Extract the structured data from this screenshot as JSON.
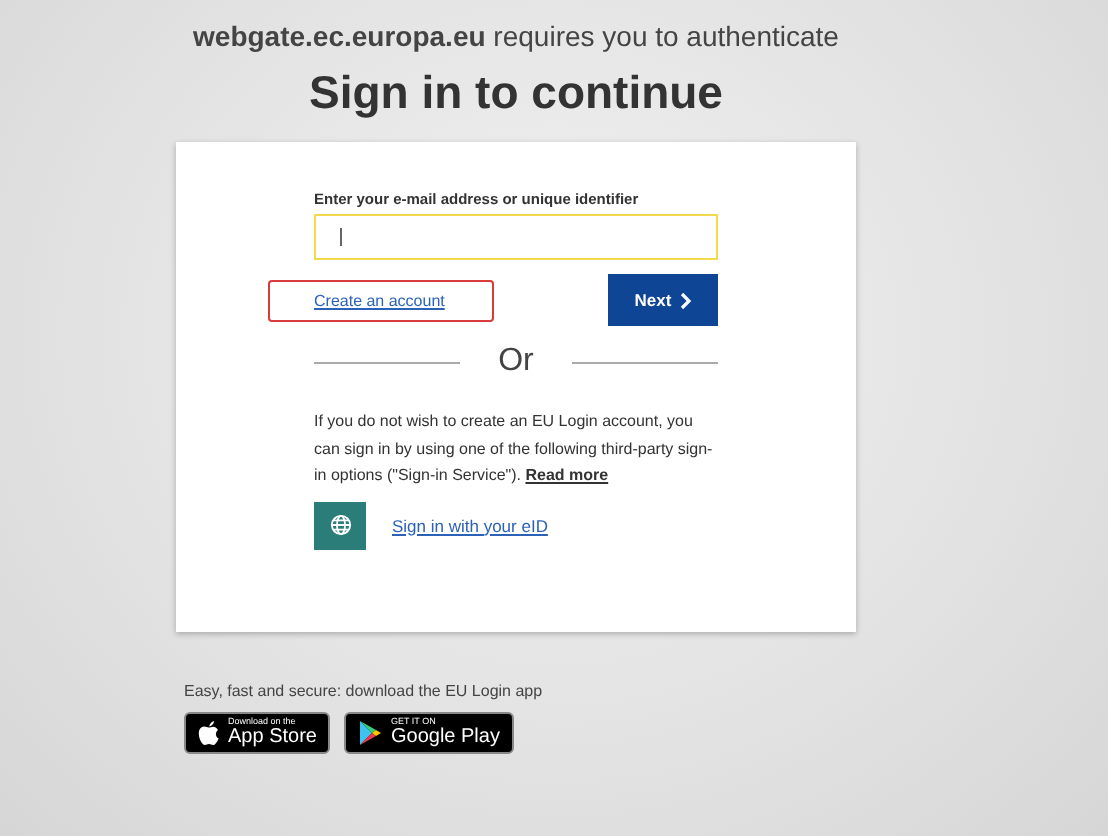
{
  "header": {
    "message": "**webgate.ec.europa.eu** requires you to authenticate",
    "title": "Sign in to continue"
  },
  "login": {
    "field_label": "Enter your e-mail address or unique identifier",
    "field_focused": true,
    "create_link": {
      "label": "Create an account",
      "highlighted": true
    },
    "next_button": {
      "label": "Next"
    },
    "separator": "Or",
    "info_text": "If you do not wish to create an EU Login account, you can sign in by using one of the following third-party sign-in options (\"Sign-in Service\").",
    "read_more": "Read more",
    "eid_link": "Sign in with your eID"
  },
  "footer": {
    "text": "Easy, fast and secure: download the EU Login app",
    "badges": [
      {
        "kind": "apple",
        "small": "Download on the",
        "big": "App Store"
      },
      {
        "kind": "google",
        "small": "GET IT ON",
        "big": "Google Play"
      }
    ]
  }
}
